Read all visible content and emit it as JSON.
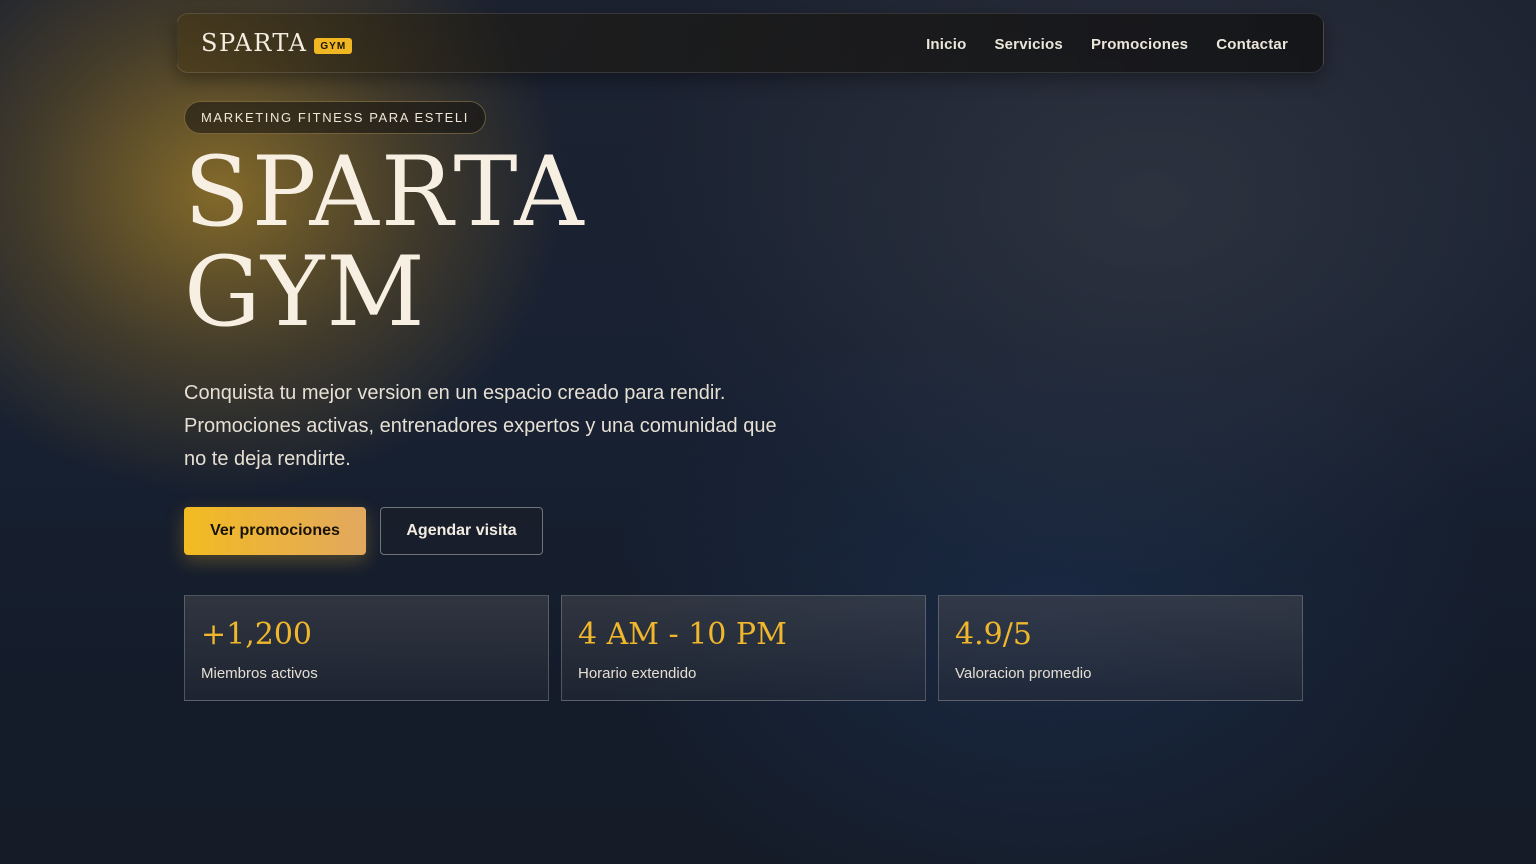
{
  "brand": {
    "name": "SPARTA",
    "tag": "GYM"
  },
  "nav": {
    "items": [
      {
        "label": "Inicio"
      },
      {
        "label": "Servicios"
      },
      {
        "label": "Promociones"
      },
      {
        "label": "Contactar"
      }
    ]
  },
  "hero": {
    "eyebrow": "MARKETING FITNESS PARA ESTELI",
    "title_line1": "SPARTA",
    "title_line2": "GYM",
    "lead": "Conquista tu mejor version en un espacio creado para rendir. Promociones activas, entrenadores expertos y una comunidad que no te deja rendirte.",
    "primary_cta": "Ver promociones",
    "secondary_cta": "Agendar visita"
  },
  "stats": [
    {
      "value": "+1,200",
      "label": "Miembros activos"
    },
    {
      "value": "4 AM - 10 PM",
      "label": "Horario extendido"
    },
    {
      "value": "4.9/5",
      "label": "Valoracion promedio"
    }
  ],
  "colors": {
    "accent": "#f0b722",
    "background": "#151c28",
    "text": "#f3ecdf"
  }
}
